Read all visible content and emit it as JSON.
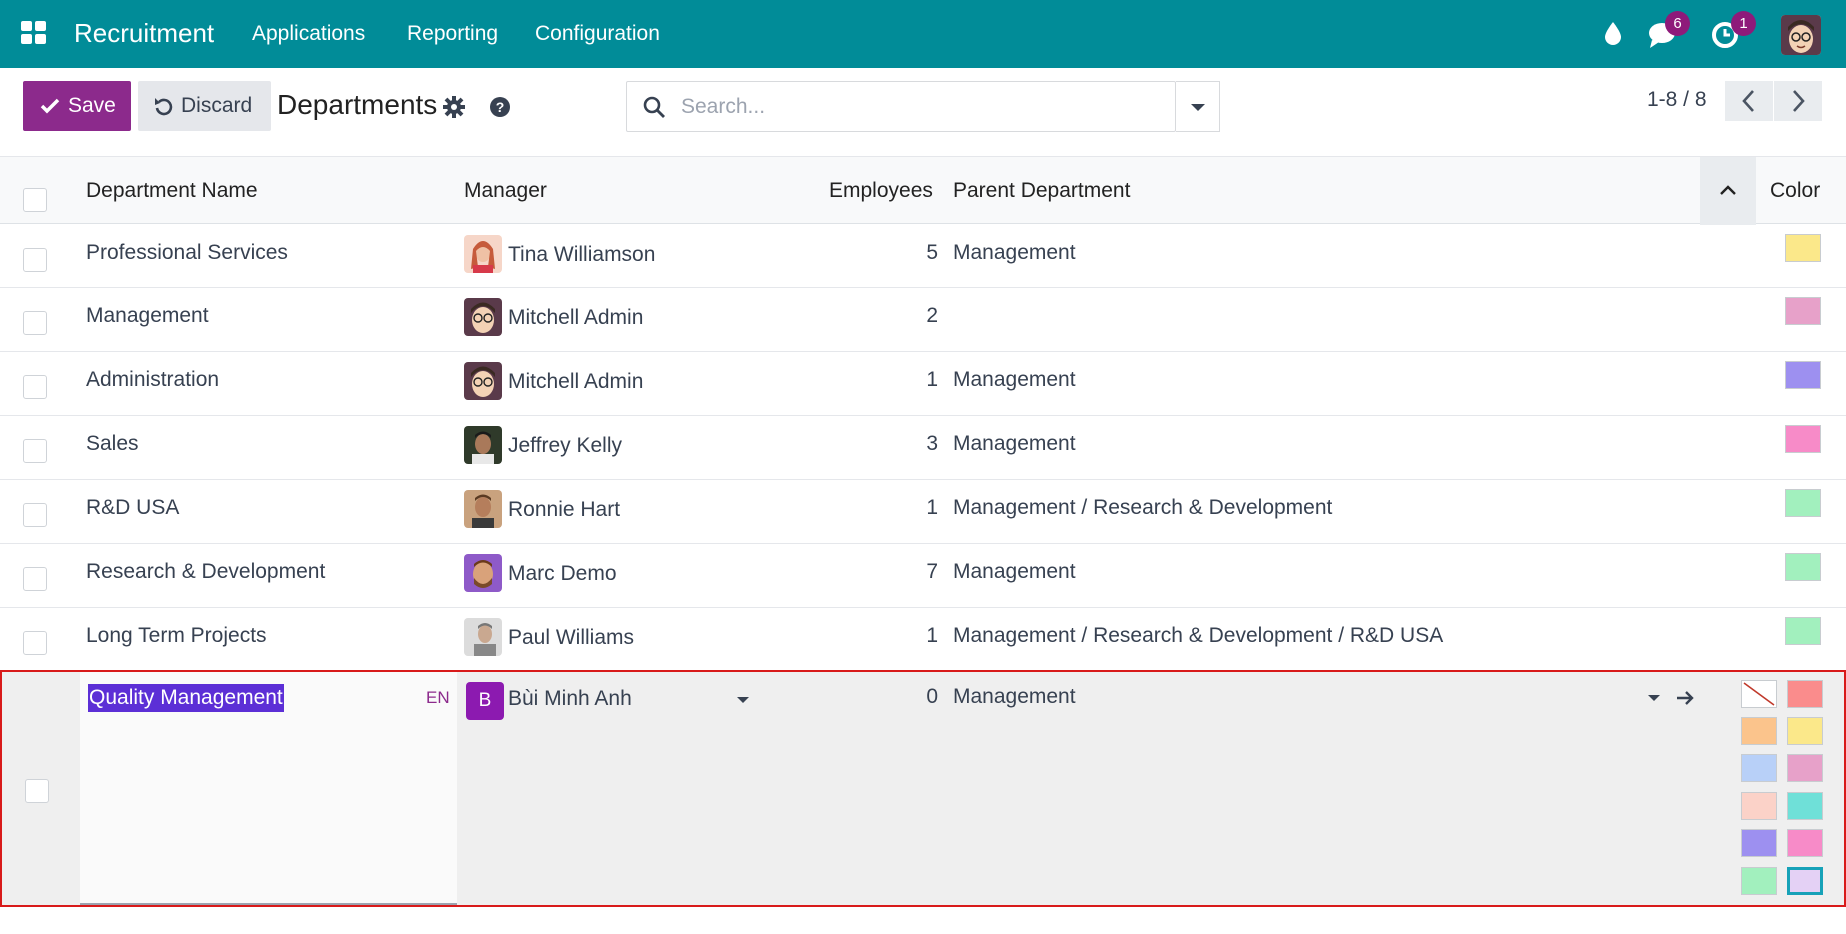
{
  "navbar": {
    "app_name": "Recruitment",
    "menus": [
      "Applications",
      "Reporting",
      "Configuration"
    ],
    "messages_count": "6",
    "activities_count": "1",
    "brand_color": "#018c98"
  },
  "toolbar": {
    "save_label": "Save",
    "discard_label": "Discard",
    "title": "Departments",
    "search_placeholder": "Search...",
    "pager_value": "1-8 / 8"
  },
  "columns": {
    "name": "Department Name",
    "manager": "Manager",
    "employees": "Employees",
    "parent": "Parent Department",
    "color": "Color"
  },
  "rows": [
    {
      "name": "Professional Services",
      "manager": "Tina Williamson",
      "employees": "5",
      "parent": "Management",
      "color": "#fbe88a"
    },
    {
      "name": "Management",
      "manager": "Mitchell Admin",
      "employees": "2",
      "parent": "",
      "color": "#e7a1c9"
    },
    {
      "name": "Administration",
      "manager": "Mitchell Admin",
      "employees": "1",
      "parent": "Management",
      "color": "#9d90f0"
    },
    {
      "name": "Sales",
      "manager": "Jeffrey Kelly",
      "employees": "3",
      "parent": "Management",
      "color": "#f78bc8"
    },
    {
      "name": "R&D USA",
      "manager": "Ronnie Hart",
      "employees": "1",
      "parent": "Management / Research & Development",
      "color": "#a2f0be"
    },
    {
      "name": "Research & Development",
      "manager": "Marc Demo",
      "employees": "7",
      "parent": "Management",
      "color": "#a2f0be"
    },
    {
      "name": "Long Term Projects",
      "manager": "Paul Williams",
      "employees": "1",
      "parent": "Management / Research & Development / R&D USA",
      "color": "#a2f0be"
    }
  ],
  "editing_row": {
    "name": "Quality Management",
    "lang": "EN",
    "manager": "Bùi Minh Anh",
    "manager_initial": "B",
    "employees": "0",
    "parent": "Management",
    "color_options": [
      "none",
      "#fa8c8c",
      "#fbc48c",
      "#fbe88a",
      "#b8d0f8",
      "#e7a1c9",
      "#fbd2c8",
      "#6fe0d8",
      "#9d90f0",
      "#f78bc8",
      "#a2f0be",
      "#e4d1f5"
    ],
    "selected_color": "#e4d1f5"
  }
}
